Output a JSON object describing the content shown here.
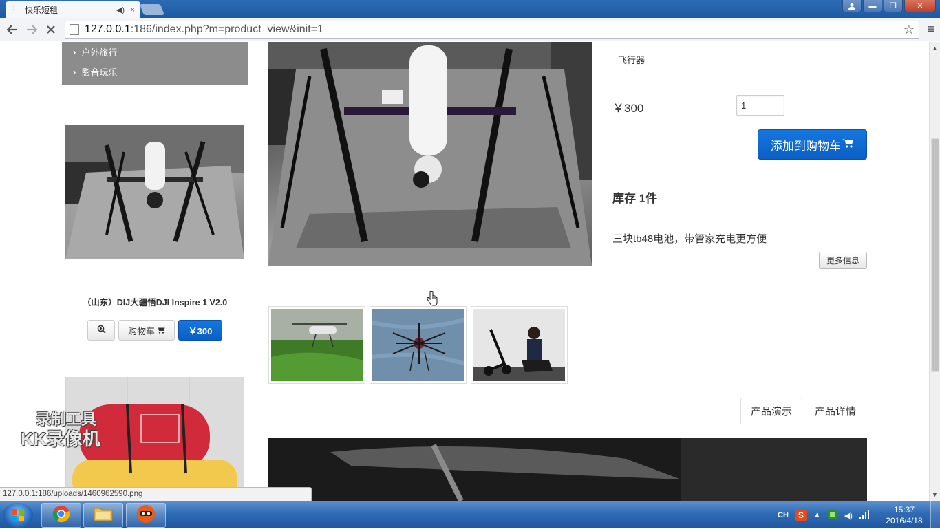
{
  "browser": {
    "tab_title": "快乐短租",
    "tab_sound_icon": "speaker-icon",
    "tab_close": "×",
    "url_host": "127.0.0.1",
    "url_path": ":186/index.php?m=product_view&init=1",
    "status_url": "127.0.0.1:186/uploads/1460962590.png"
  },
  "window_controls": {
    "minimize": "▬",
    "restore": "❐",
    "close": "✕"
  },
  "sidebar": {
    "categories": [
      {
        "label": "户外旅行"
      },
      {
        "label": "影音玩乐"
      }
    ]
  },
  "side_product": {
    "title": "（山东）DIJ大疆悟DJI Inspire 1 V2.0",
    "cart_label": "购物车",
    "price_label": "￥300"
  },
  "product": {
    "category": "- 飞行器",
    "price": "￥300",
    "quantity": "1",
    "add_to_cart": "添加到购物车",
    "stock": "库存 1件",
    "description": "三块tb48电池，带管家充电更方便",
    "more_info": "更多信息",
    "thumbnails": [
      {
        "name": "thumb-helicopter"
      },
      {
        "name": "thumb-octocopter"
      },
      {
        "name": "thumb-person-scooter"
      }
    ],
    "tabs": [
      {
        "label": "产品演示",
        "active": true
      },
      {
        "label": "产品详情",
        "active": false
      }
    ]
  },
  "watermark": {
    "line1": "录制工具",
    "line2": "KK录像机"
  },
  "taskbar": {
    "ime": "CH",
    "sogou": "S",
    "time": "15:37",
    "date": "2016/4/18"
  },
  "colors": {
    "accent_blue": "#0a5fc4",
    "sidebar_gray": "#8c8c8c"
  }
}
